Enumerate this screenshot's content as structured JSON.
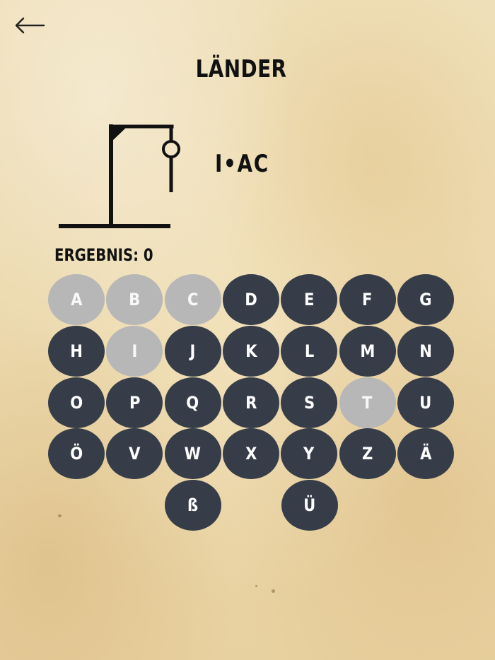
{
  "header": {
    "back_label": "←"
  },
  "game": {
    "category": "LÄNDER",
    "word_display": "I•AC",
    "score_label": "ERGEBNIS:",
    "score_value": "0"
  },
  "keyboard": {
    "rows": [
      [
        {
          "label": "A",
          "used": true
        },
        {
          "label": "B",
          "used": true
        },
        {
          "label": "C",
          "used": true
        },
        {
          "label": "D",
          "used": false
        },
        {
          "label": "E",
          "used": false
        },
        {
          "label": "F",
          "used": false
        },
        {
          "label": "G",
          "used": false
        }
      ],
      [
        {
          "label": "H",
          "used": false
        },
        {
          "label": "I",
          "used": true
        },
        {
          "label": "J",
          "used": false
        },
        {
          "label": "K",
          "used": false
        },
        {
          "label": "L",
          "used": false
        },
        {
          "label": "M",
          "used": false
        },
        {
          "label": "N",
          "used": false
        }
      ],
      [
        {
          "label": "O",
          "used": false
        },
        {
          "label": "P",
          "used": false
        },
        {
          "label": "Q",
          "used": false
        },
        {
          "label": "R",
          "used": false
        },
        {
          "label": "S",
          "used": false
        },
        {
          "label": "T",
          "used": true
        },
        {
          "label": "U",
          "used": false
        }
      ],
      [
        {
          "label": "Ö",
          "used": false
        },
        {
          "label": "V",
          "used": false
        },
        {
          "label": "W",
          "used": false
        },
        {
          "label": "X",
          "used": false
        },
        {
          "label": "Y",
          "used": false
        },
        {
          "label": "Z",
          "used": false
        },
        {
          "label": "Ä",
          "used": false
        }
      ],
      [
        {
          "label": "ß",
          "used": false
        },
        {
          "label": "Ü",
          "used": false
        }
      ]
    ]
  },
  "colors": {
    "key_active": "#363d49",
    "key_used": "#b7b7b7",
    "text_dark": "#111111"
  }
}
